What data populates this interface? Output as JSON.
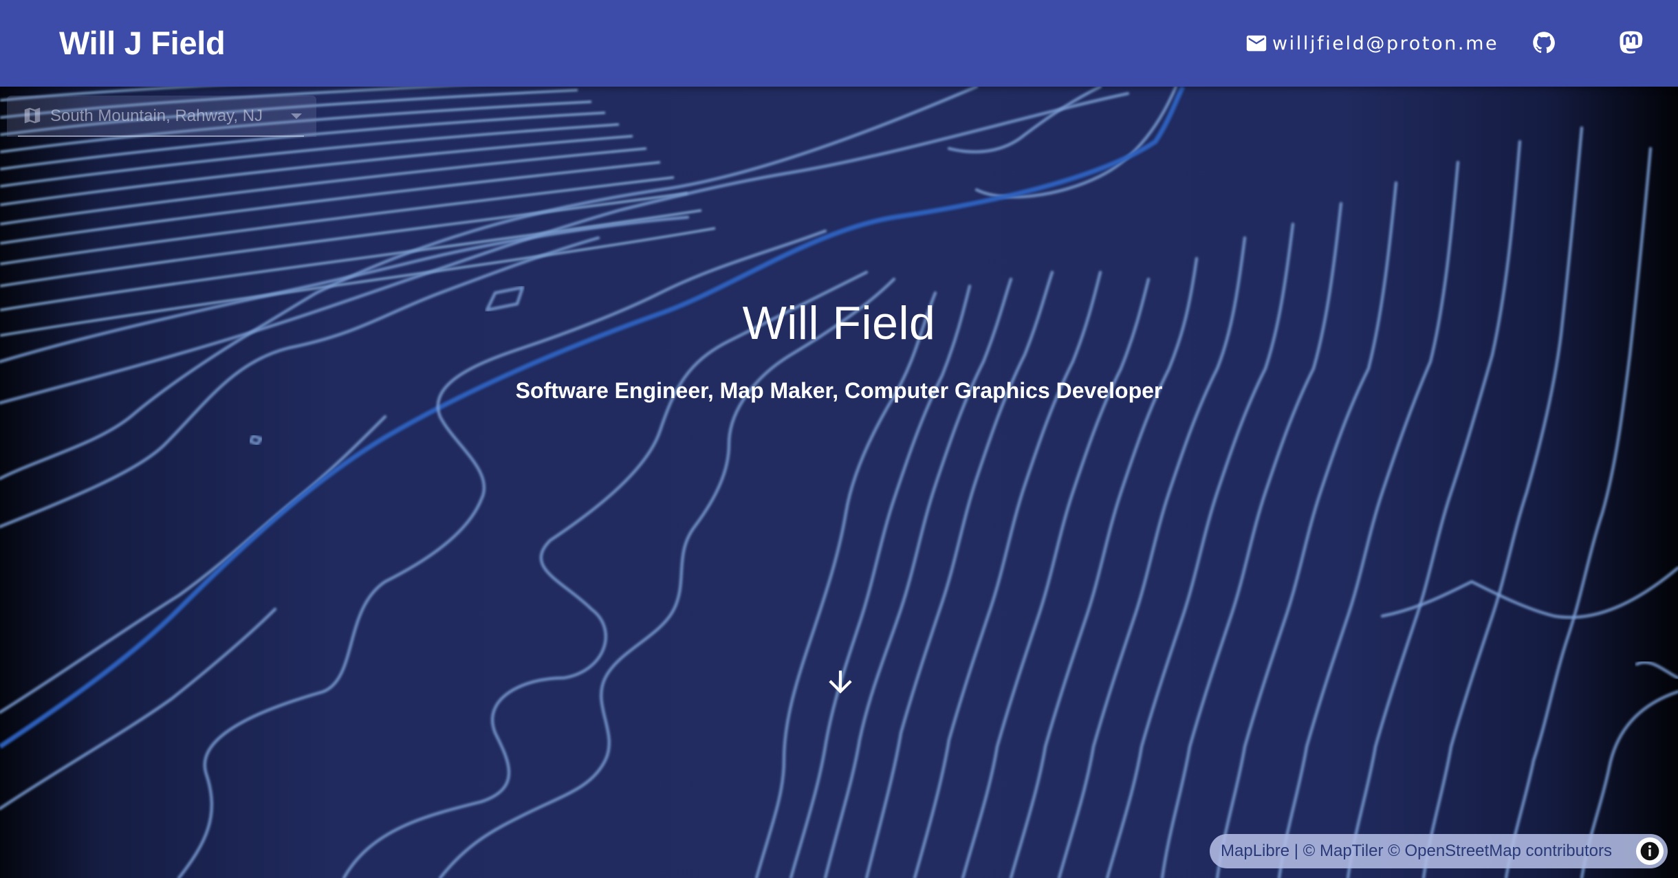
{
  "header": {
    "brand": "Will J Field",
    "email": "willjfield@proton.me",
    "icons": {
      "email": "mail-icon",
      "github": "github-icon",
      "mastodon": "mastodon-icon"
    }
  },
  "location_select": {
    "value": "South Mountain, Rahway, NJ",
    "icon": "map-icon"
  },
  "hero": {
    "title": "Will Field",
    "subtitle": "Software Engineer, Map Maker, Computer Graphics Developer",
    "scroll_icon": "arrow-down-icon"
  },
  "attribution": {
    "text": "MapLibre | © MapTiler © OpenStreetMap contributors",
    "icon": "info-icon"
  },
  "colors": {
    "app_bar": "#3c4ca8",
    "map_background": "#222c60",
    "contour": "#7c9fd4",
    "river": "#2f63c2"
  }
}
